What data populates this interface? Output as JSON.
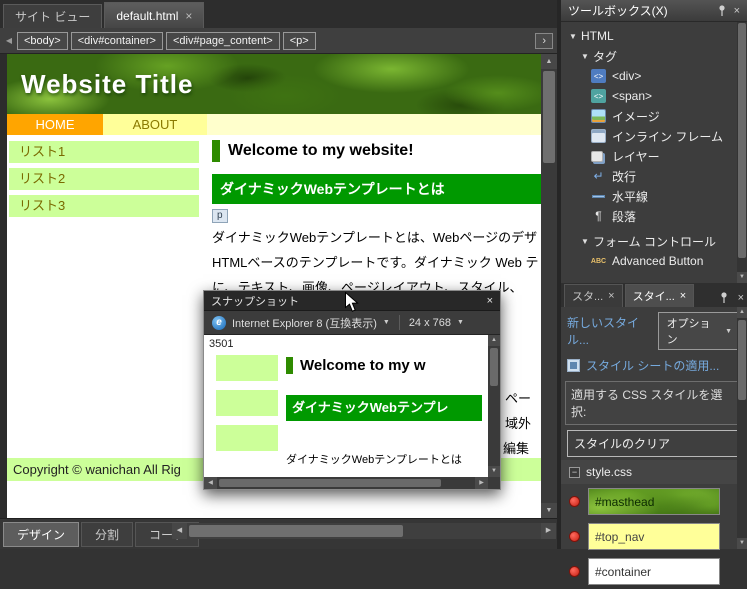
{
  "icons": {
    "close": "×",
    "collapse": "▼",
    "dropdown": "▼",
    "up": "▲",
    "down": "▼",
    "left": "◀",
    "right": "▶",
    "more": "›",
    "prev": "◀",
    "minus": "−",
    "paragraph": "¶",
    "linebreak": "↵",
    "tag": "<>",
    "abc": "ABC",
    "ie": "e"
  },
  "window": {
    "tabs": [
      {
        "label": "サイト ビュー"
      },
      {
        "label": "default.html"
      }
    ],
    "breadcrumb": [
      "<body>",
      "<div#container>",
      "<div#page_content>",
      "<p>"
    ],
    "view_buttons": [
      "デザイン",
      "分割",
      "コード"
    ]
  },
  "page": {
    "masthead_title": "Website Title",
    "nav_home": "HOME",
    "nav_about": "ABOUT",
    "list_items": [
      "リスト1",
      "リスト2",
      "リスト3"
    ],
    "heading": "Welcome to my website!",
    "section_title": "ダイナミックWebテンプレートとは",
    "p_tag_label": "p",
    "paragraph_lines": [
      "ダイナミックWebテンプレートとは、Webページのデザ",
      "HTMLベースのテンプレートです。ダイナミック Web テ",
      "に、テキスト、画像、ページレイアウト、スタイル、"
    ],
    "occluded_fragments": [
      "ペー",
      "域外",
      "編集"
    ],
    "copyright": "Copyright © wanichan All Rig"
  },
  "snapshot": {
    "title": "スナップショット",
    "browser_label": "Internet Explorer 8 (互換表示)",
    "resolution_label": "24 x 768",
    "preview": {
      "fragment": "3501",
      "heading": "Welcome to my w",
      "section_title": "ダイナミックWebテンプレ",
      "body_text": "ダイナミックWebテンプレートとは"
    }
  },
  "toolbox": {
    "title": "ツールボックス(X)",
    "group_html": "HTML",
    "group_tag": "タグ",
    "tag_items": [
      "<div>",
      "<span>",
      "イメージ",
      "インライン フレーム",
      "レイヤー",
      "改行",
      "水平線",
      "段落"
    ],
    "group_form": "フォーム コントロール",
    "form_items": [
      "Advanced Button"
    ]
  },
  "styles": {
    "tab_apply": "スタ...",
    "tab_manage": "スタイ...",
    "new_style": "新しいスタイル...",
    "options_button": "オプション",
    "attach_stylesheet": "スタイル シートの適用...",
    "select_label": "適用する CSS スタイルを選択:",
    "clear_styles": "スタイルのクリア",
    "stylesheet": "style.css",
    "rules": [
      "#masthead",
      "#top_nav",
      "#container"
    ]
  },
  "colors": {
    "accent_green": "#009900",
    "list_green": "#ccff99",
    "nav_yellow": "#ffff99",
    "nav_orange": "#ffa500"
  }
}
